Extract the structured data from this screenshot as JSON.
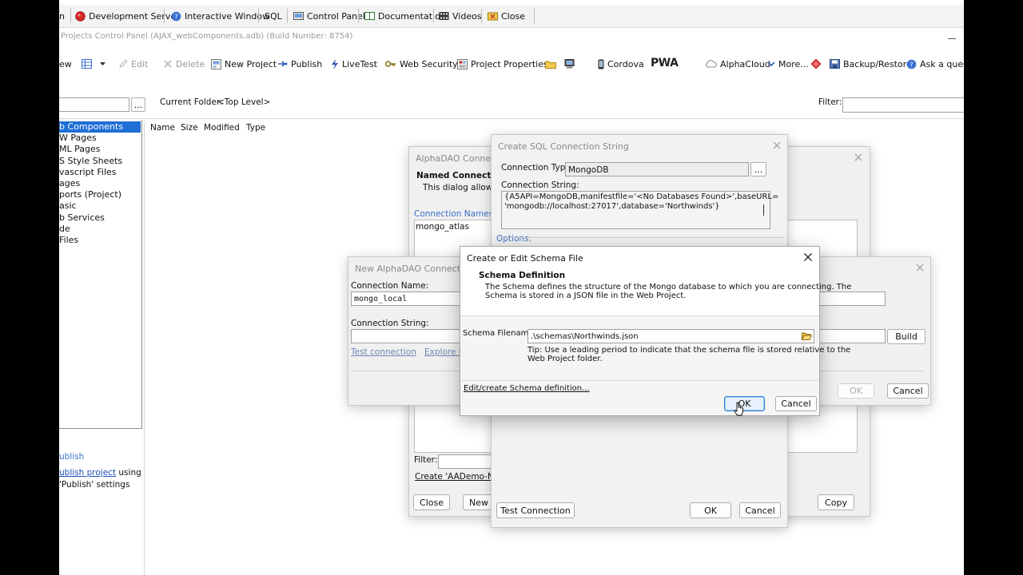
{
  "toolbar": {
    "items": [
      {
        "label": "n"
      },
      {
        "label": "Development Server"
      },
      {
        "label": "Interactive Window"
      },
      {
        "label": "SQL"
      },
      {
        "label": "Control Panel"
      },
      {
        "label": "Documentation"
      },
      {
        "label": "Videos"
      },
      {
        "label": "Close"
      }
    ]
  },
  "window_title": "Projects Control Panel (AJAX_webComponents.adb) (Build Number: 8754)",
  "actions": {
    "view": "ew",
    "edit": "Edit",
    "delete": "Delete",
    "new_project": "New Project",
    "publish": "Publish",
    "livetest": "LiveTest",
    "web_security": "Web Security",
    "project_properties": "Project Properties",
    "cordova": "Cordova",
    "pwa": "PWA",
    "alphacloud": "AlphaCloud",
    "more": "More...",
    "backup_restore": "Backup/Restore",
    "ask": "Ask a questio"
  },
  "folder_bar": {
    "browse_button": "...",
    "current_folder_label": "Current Folder:",
    "current_folder_value": "<Top Level>",
    "filter_label": "Filter:"
  },
  "tree": {
    "items": [
      "b Components",
      "W Pages",
      "ML Pages",
      "S Style Sheets",
      "vascript Files",
      "ages",
      "ports (Project)",
      "asic",
      "b Services",
      "de",
      "Files"
    ]
  },
  "file_list": {
    "columns": [
      "Name",
      "Size",
      "Modified",
      "Type"
    ]
  },
  "publish_panel": {
    "header": "ublish",
    "link": "ublish project",
    "link_suffix": " using",
    "line2": "'Publish' settings"
  },
  "alphadao_dialog": {
    "title": "AlphaDAO Connecti",
    "heading": "Named Connection",
    "description": "This dialog allows yo",
    "list_label": "Connection Names",
    "list_items": [
      "mongo_atlas"
    ],
    "filter_label": "Filter:",
    "create_link": "Create 'AADemo-North",
    "close_button": "Close",
    "new_button": "New",
    "copy_button": "Copy"
  },
  "sql_dialog": {
    "title": "Create SQL Connection String",
    "type_label": "Connection Type:",
    "type_value": "MongoDB",
    "type_button": "...",
    "string_label": "Connection String:",
    "string_line1": "{A5API=MongoDB,manifestfile='<No Databases Found>',baseURL=",
    "string_line2": "'mongodb://localhost:27017',database='Northwinds'}",
    "options_label": "Options:",
    "test_button": "Test Connection",
    "ok_button": "OK",
    "cancel_button": "Cancel"
  },
  "new_dialog": {
    "title": "New AlphaDAO Connection",
    "name_label": "Connection Name:",
    "name_value": "mongo_local",
    "string_label": "Connection String:",
    "test_link": "Test connection",
    "explore_link": "Explore Da",
    "build_button": "Build",
    "ok_button": "OK",
    "cancel_button": "Cancel"
  },
  "schema_dialog": {
    "title": "Create or Edit Schema File",
    "heading": "Schema Definition",
    "description_line1": "The Schema defines the structure of the Mongo database to which you are connecting. The",
    "description_line2": "Schema is stored in a JSON file in the Web Project.",
    "filename_label": "Schema Filename:",
    "filename_value": ".\\schemas\\Northwinds.json",
    "tip_line1": "Tip: Use a leading period to indicate that the schema file is stored relative to the",
    "tip_line2": "Web Project folder.",
    "edit_link": "Edit/create Schema definition...",
    "ok_button": "OK",
    "cancel_button": "Cancel"
  },
  "colors": {
    "selection": "#1f6fd6",
    "link": "#1a4fb5",
    "accent_red": "#d12a2a"
  }
}
